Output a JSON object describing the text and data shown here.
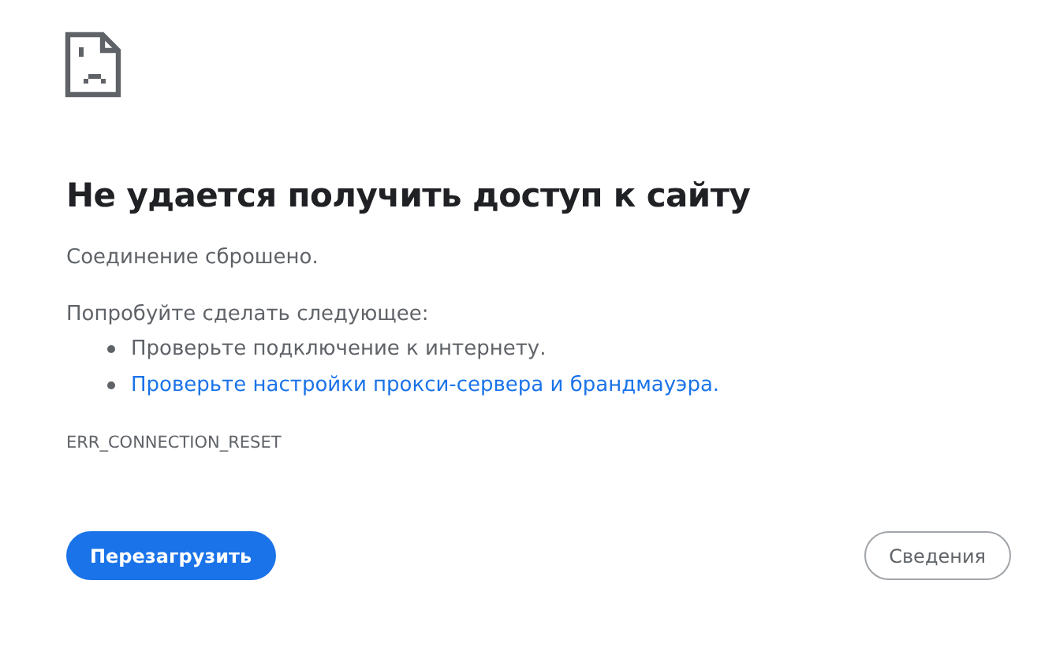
{
  "heading": "Не удается получить доступ к сайту",
  "message": "Соединение сброшено.",
  "suggestions_intro": "Попробуйте сделать следующее:",
  "suggestions": [
    {
      "kind": "text",
      "text": "Проверьте подключение к интернету."
    },
    {
      "kind": "link",
      "text": "Проверьте настройки прокси-сервера и брандмауэра."
    }
  ],
  "error_code": "ERR_CONNECTION_RESET",
  "buttons": [
    {
      "kind": "primary",
      "label": "Перезагрузить"
    },
    {
      "kind": "secondary",
      "label": "Сведения"
    }
  ]
}
